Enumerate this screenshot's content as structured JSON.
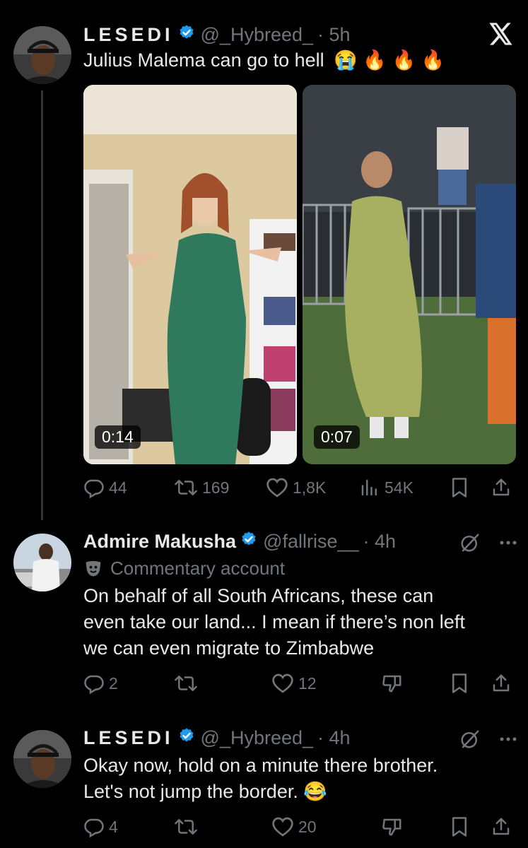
{
  "colors": {
    "background": "#000000",
    "text": "#e7e9ea",
    "muted": "#71767b",
    "verified": "#1d9bf0"
  },
  "tweet1": {
    "display_name": "LESEDI",
    "handle": "@_Hybreed_",
    "time": "· 5h",
    "text": "Julius Malema can go to hell",
    "emojis": [
      "😭",
      "🔥",
      "🔥",
      "🔥"
    ],
    "media": [
      {
        "duration": "0:14"
      },
      {
        "duration": "0:07"
      }
    ],
    "actions": {
      "replies": "44",
      "reposts": "169",
      "likes": "1,8K",
      "views": "54K"
    }
  },
  "reply1": {
    "display_name": "Admire Makusha",
    "handle": "@fallrise__",
    "time": "· 4h",
    "label": "Commentary account",
    "text": [
      "On behalf of all South Africans, these can",
      "even take our land... I mean if there’s non left",
      "we can even migrate to Zimbabwe"
    ],
    "actions": {
      "replies": "2",
      "reposts": "",
      "likes": "12"
    }
  },
  "reply2": {
    "display_name": "LESEDI",
    "handle": "@_Hybreed_",
    "time": "· 4h",
    "text": [
      "Okay now, hold on a minute there brother.",
      "Let's not jump the border."
    ],
    "emoji": "😂",
    "actions": {
      "replies": "4",
      "reposts": "",
      "likes": "20"
    }
  },
  "icons": {
    "close": "x-logo-icon",
    "more": "more-icon",
    "grok": "grok-icon"
  }
}
